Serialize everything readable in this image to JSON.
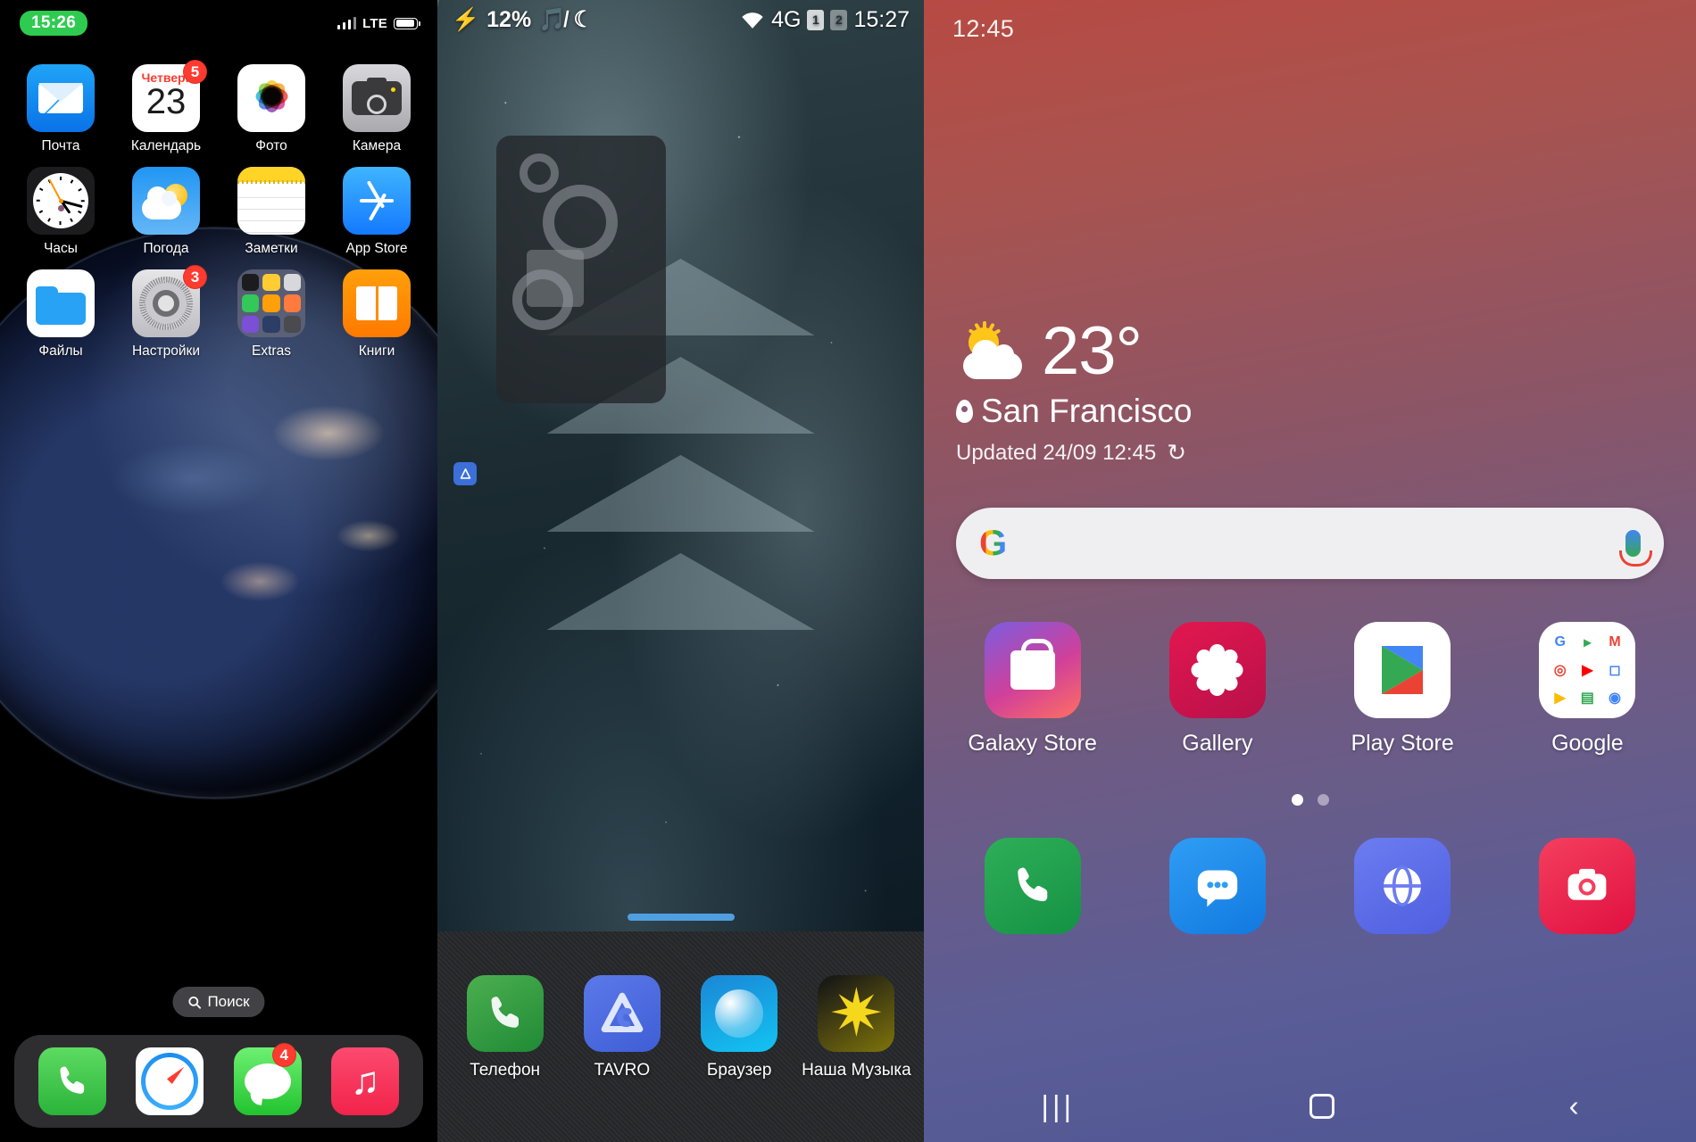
{
  "iphone": {
    "status": {
      "time": "15:26",
      "network": "LTE",
      "signal_icon": "signal-bars-icon",
      "battery_icon": "battery-icon"
    },
    "apps": [
      [
        {
          "label": "Почта",
          "icon": "mail-icon",
          "badge": ""
        },
        {
          "label": "Календарь",
          "icon": "calendar-icon",
          "badge": "5",
          "day_of_week": "Четверг",
          "day_number": "23"
        },
        {
          "label": "Фото",
          "icon": "photos-icon",
          "badge": ""
        },
        {
          "label": "Камера",
          "icon": "camera-icon",
          "badge": ""
        }
      ],
      [
        {
          "label": "Часы",
          "icon": "clock-icon",
          "badge": ""
        },
        {
          "label": "Погода",
          "icon": "weather-icon",
          "badge": ""
        },
        {
          "label": "Заметки",
          "icon": "notes-icon",
          "badge": ""
        },
        {
          "label": "App Store",
          "icon": "app-store-icon",
          "badge": ""
        }
      ],
      [
        {
          "label": "Файлы",
          "icon": "files-icon",
          "badge": ""
        },
        {
          "label": "Настройки",
          "icon": "settings-icon",
          "badge": "3"
        },
        {
          "label": "Extras",
          "icon": "folder-icon",
          "badge": ""
        },
        {
          "label": "Книги",
          "icon": "books-icon",
          "badge": ""
        }
      ]
    ],
    "search": {
      "label": "Поиск",
      "icon": "search-icon"
    },
    "dock": [
      {
        "label": "Phone",
        "icon": "phone-icon",
        "badge": ""
      },
      {
        "label": "Safari",
        "icon": "safari-icon",
        "badge": ""
      },
      {
        "label": "Messages",
        "icon": "messages-icon",
        "badge": "4"
      },
      {
        "label": "Music",
        "icon": "music-icon",
        "badge": ""
      }
    ]
  },
  "android": {
    "status": {
      "battery_percent": "12%",
      "charging_icon": "charging-bolt-icon",
      "mute_icon": "music-muted-icon",
      "dnd_icon": "moon-icon",
      "wifi_icon": "wifi-icon",
      "network": "4G",
      "sim1": "1",
      "sim2": "2",
      "time": "15:27"
    },
    "widget": {
      "name": "settings-gears-widget"
    },
    "dock": [
      {
        "label": "Телефон",
        "icon": "phone-icon"
      },
      {
        "label": "TAVRO",
        "icon": "tavro-icon"
      },
      {
        "label": "Браузер",
        "icon": "browser-icon"
      },
      {
        "label": "Наша Музыка",
        "icon": "music-star-icon"
      }
    ]
  },
  "samsung": {
    "status": {
      "time": "12:45"
    },
    "weather": {
      "icon": "partly-cloudy-icon",
      "temperature": "23°",
      "city": "San Francisco",
      "location_icon": "location-pin-icon",
      "updated": "Updated 24/09 12:45",
      "refresh_icon": "refresh-icon"
    },
    "search": {
      "placeholder": "",
      "google_icon": "google-g-icon",
      "mic_icon": "microphone-icon"
    },
    "apps": [
      {
        "label": "Galaxy Store",
        "icon": "galaxy-store-icon"
      },
      {
        "label": "Gallery",
        "icon": "gallery-icon"
      },
      {
        "label": "Play Store",
        "icon": "play-store-icon"
      },
      {
        "label": "Google",
        "icon": "google-folder-icon"
      }
    ],
    "page_dots": {
      "count": 2,
      "active": 0
    },
    "dock": [
      {
        "label": "Phone",
        "icon": "phone-icon"
      },
      {
        "label": "Messages",
        "icon": "messages-icon"
      },
      {
        "label": "Internet",
        "icon": "internet-icon"
      },
      {
        "label": "Camera",
        "icon": "camera-icon"
      }
    ],
    "navbar": {
      "recents_icon": "recents-icon",
      "recents_glyph": "|||",
      "home_icon": "home-icon",
      "back_icon": "back-icon",
      "back_glyph": "‹"
    }
  }
}
